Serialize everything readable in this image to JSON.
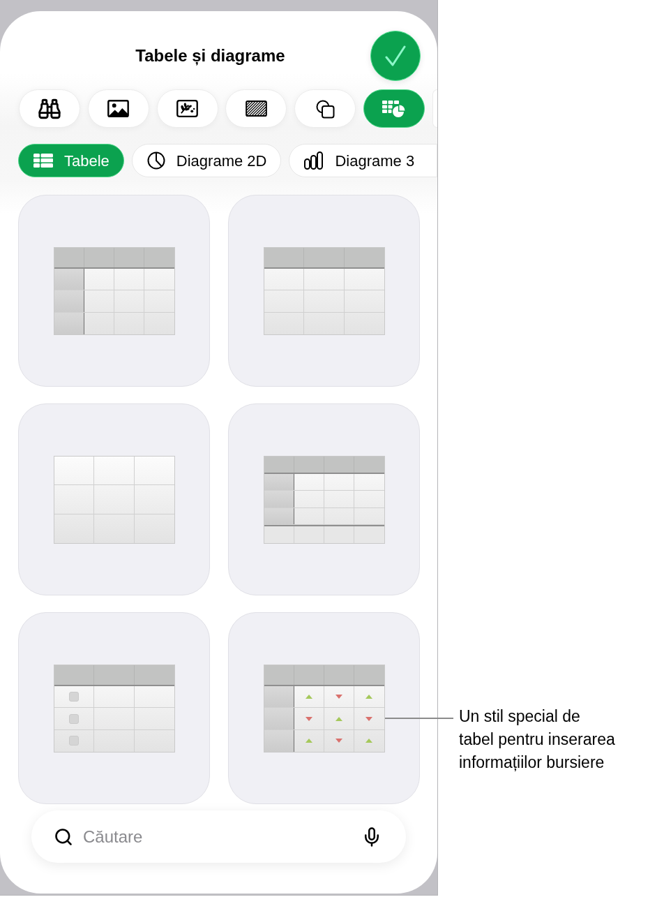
{
  "title": "Tabele și diagrame",
  "tools": [
    {
      "selected": false
    },
    {
      "selected": false
    },
    {
      "selected": false
    },
    {
      "selected": false
    },
    {
      "selected": false
    },
    {
      "selected": true
    }
  ],
  "categories": [
    {
      "label": "Tabele",
      "selected": true
    },
    {
      "label": "Diagrame 2D",
      "selected": false
    },
    {
      "label": "Diagrame 3",
      "selected": false
    }
  ],
  "table_styles": [
    {
      "kind": "headers"
    },
    {
      "kind": "topheader"
    },
    {
      "kind": "plain"
    },
    {
      "kind": "footer"
    },
    {
      "kind": "checklist"
    },
    {
      "kind": "stock"
    }
  ],
  "search": {
    "placeholder": "Căutare"
  },
  "callout": "Un stil special de\ntabel pentru inserarea\ninformațiilor bursiere"
}
